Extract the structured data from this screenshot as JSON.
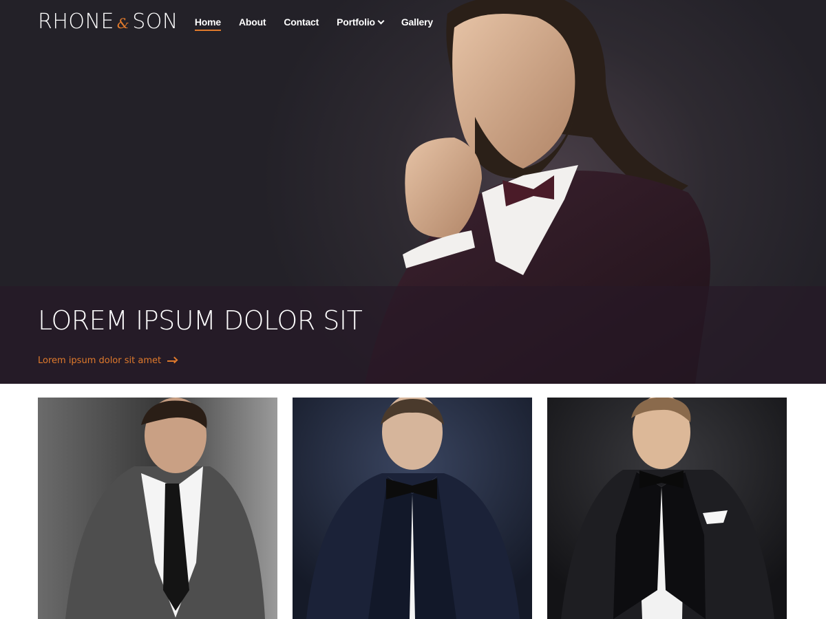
{
  "brand": {
    "logo_left": "RHONE",
    "logo_amp": "&",
    "logo_right": "SON",
    "accent_color": "#e07a2c"
  },
  "nav": {
    "items": [
      {
        "label": "Home",
        "active": true
      },
      {
        "label": "About",
        "active": false
      },
      {
        "label": "Contact",
        "active": false
      },
      {
        "label": "Portfolio",
        "active": false,
        "has_dropdown": true
      },
      {
        "label": "Gallery",
        "active": false
      }
    ]
  },
  "hero": {
    "title": "LOREM IPSUM DOLOR SIT",
    "link_text": "Lorem ipsum dolor sit amet",
    "link_icon": "arrow-right-icon",
    "image": "man-in-burgundy-suit-photo"
  },
  "gallery": {
    "cards": [
      {
        "image": "man-in-grey-suit-photo"
      },
      {
        "image": "man-in-navy-tuxedo-photo"
      },
      {
        "image": "man-in-black-tuxedo-photo"
      }
    ]
  }
}
